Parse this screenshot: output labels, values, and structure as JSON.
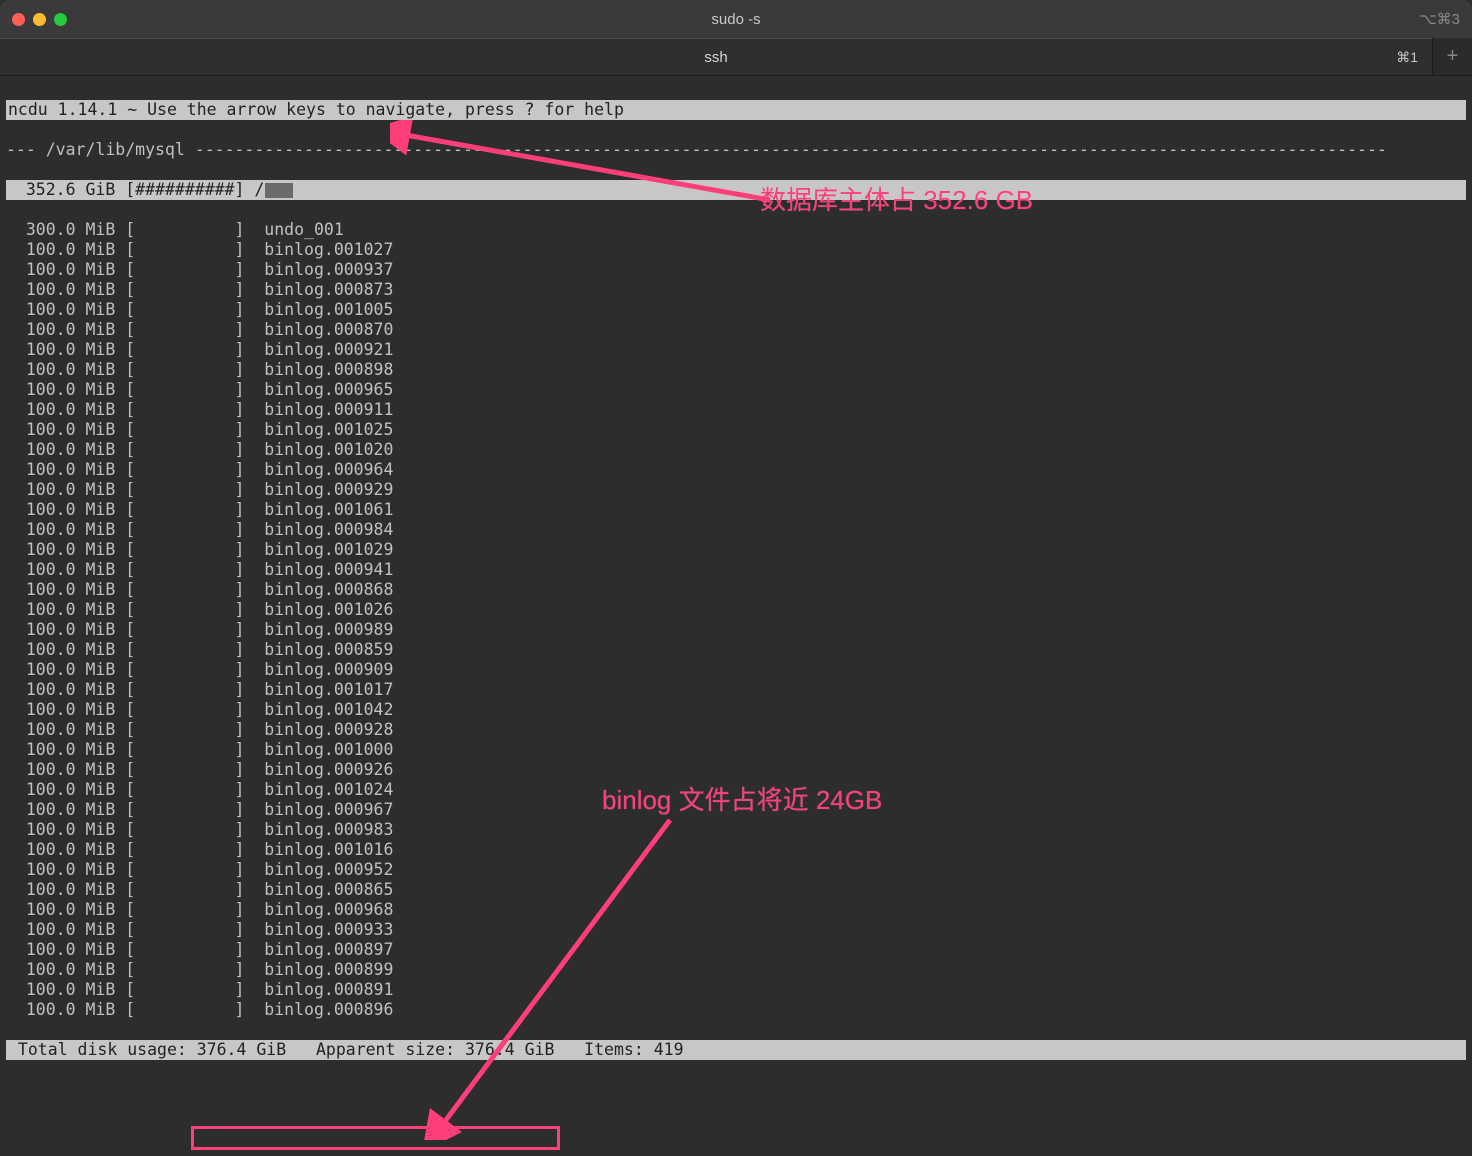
{
  "window": {
    "title": "sudo -s",
    "right_badge": "⌥⌘3"
  },
  "tab": {
    "label": "ssh",
    "shortcut": "⌘1",
    "plus": "+"
  },
  "ncdu": {
    "header": "ncdu 1.14.1 ~ Use the arrow keys to navigate, press ? for help",
    "path_prefix": "---",
    "path": "/var/lib/mysql",
    "selected": {
      "size": "352.6 GiB",
      "bar": "[##########]",
      "name": "/"
    },
    "rows": [
      {
        "size": "300.0 MiB",
        "name": "undo_001"
      },
      {
        "size": "100.0 MiB",
        "name": "binlog.001027"
      },
      {
        "size": "100.0 MiB",
        "name": "binlog.000937"
      },
      {
        "size": "100.0 MiB",
        "name": "binlog.000873"
      },
      {
        "size": "100.0 MiB",
        "name": "binlog.001005"
      },
      {
        "size": "100.0 MiB",
        "name": "binlog.000870"
      },
      {
        "size": "100.0 MiB",
        "name": "binlog.000921"
      },
      {
        "size": "100.0 MiB",
        "name": "binlog.000898"
      },
      {
        "size": "100.0 MiB",
        "name": "binlog.000965"
      },
      {
        "size": "100.0 MiB",
        "name": "binlog.000911"
      },
      {
        "size": "100.0 MiB",
        "name": "binlog.001025"
      },
      {
        "size": "100.0 MiB",
        "name": "binlog.001020"
      },
      {
        "size": "100.0 MiB",
        "name": "binlog.000964"
      },
      {
        "size": "100.0 MiB",
        "name": "binlog.000929"
      },
      {
        "size": "100.0 MiB",
        "name": "binlog.001061"
      },
      {
        "size": "100.0 MiB",
        "name": "binlog.000984"
      },
      {
        "size": "100.0 MiB",
        "name": "binlog.001029"
      },
      {
        "size": "100.0 MiB",
        "name": "binlog.000941"
      },
      {
        "size": "100.0 MiB",
        "name": "binlog.000868"
      },
      {
        "size": "100.0 MiB",
        "name": "binlog.001026"
      },
      {
        "size": "100.0 MiB",
        "name": "binlog.000989"
      },
      {
        "size": "100.0 MiB",
        "name": "binlog.000859"
      },
      {
        "size": "100.0 MiB",
        "name": "binlog.000909"
      },
      {
        "size": "100.0 MiB",
        "name": "binlog.001017"
      },
      {
        "size": "100.0 MiB",
        "name": "binlog.001042"
      },
      {
        "size": "100.0 MiB",
        "name": "binlog.000928"
      },
      {
        "size": "100.0 MiB",
        "name": "binlog.001000"
      },
      {
        "size": "100.0 MiB",
        "name": "binlog.000926"
      },
      {
        "size": "100.0 MiB",
        "name": "binlog.001024"
      },
      {
        "size": "100.0 MiB",
        "name": "binlog.000967"
      },
      {
        "size": "100.0 MiB",
        "name": "binlog.000983"
      },
      {
        "size": "100.0 MiB",
        "name": "binlog.001016"
      },
      {
        "size": "100.0 MiB",
        "name": "binlog.000952"
      },
      {
        "size": "100.0 MiB",
        "name": "binlog.000865"
      },
      {
        "size": "100.0 MiB",
        "name": "binlog.000968"
      },
      {
        "size": "100.0 MiB",
        "name": "binlog.000933"
      },
      {
        "size": "100.0 MiB",
        "name": "binlog.000897"
      },
      {
        "size": "100.0 MiB",
        "name": "binlog.000899"
      },
      {
        "size": "100.0 MiB",
        "name": "binlog.000891"
      },
      {
        "size": "100.0 MiB",
        "name": "binlog.000896"
      }
    ],
    "status": {
      "prefix": " Total disk usage: ",
      "disk_usage": "376.4 GiB",
      "middle": "   Apparent size: ",
      "apparent_size": "376.4 GiB",
      "suffix": "   Items: 419"
    }
  },
  "annotations": {
    "top": "数据库主体占 352.6 GB",
    "bottom": "binlog 文件占将近 24GB"
  }
}
